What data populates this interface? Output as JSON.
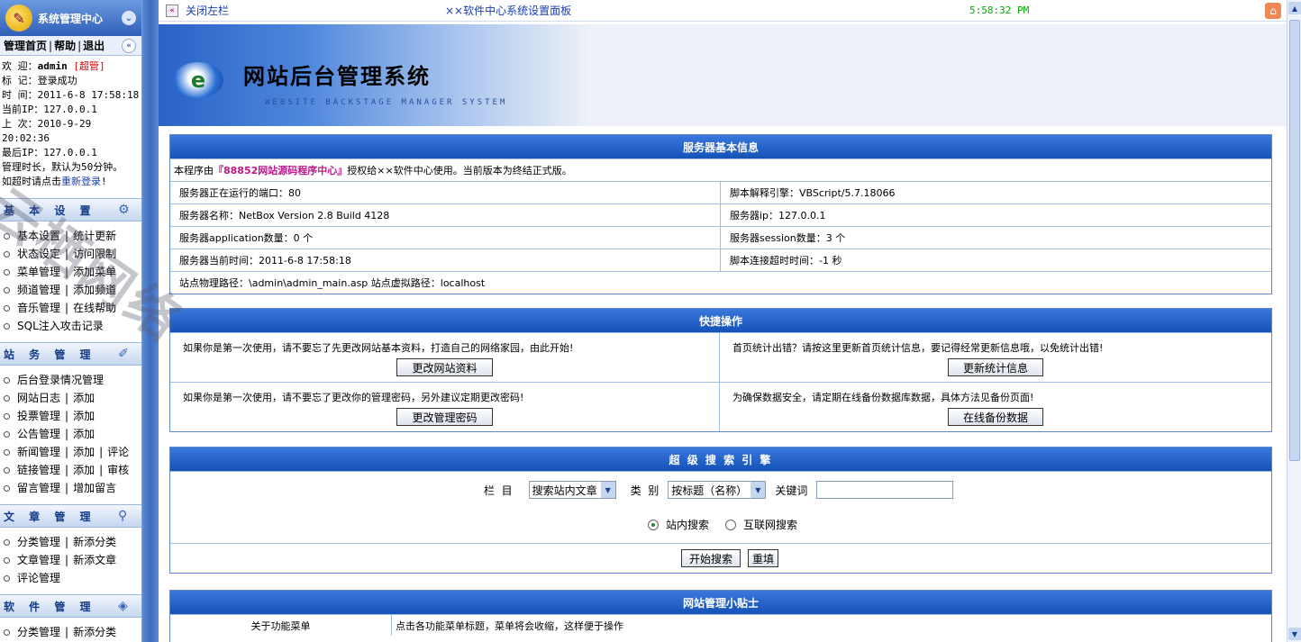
{
  "sidebar": {
    "title": "系统管理中心",
    "links": [
      "管理首页",
      "帮助",
      "退出"
    ],
    "info": {
      "welcome_label": "欢 迎：",
      "user": "admin",
      "role": "[超管]",
      "mark": "标 记：登录成功",
      "time": "时 间：2011-6-8 17:58:18",
      "ip": "当前IP：127.0.0.1",
      "last": "上 次：2010-9-29 20:02:36",
      "last_ip": "最后IP：127.0.0.1",
      "duration": "管理时长，默认为50分钟。",
      "timeout_prefix": "如超时请点击",
      "relogin": "重新登录",
      "timeout_suffix": "!"
    },
    "sections": [
      {
        "title": "基 本 设 置",
        "icon": "settings-icon",
        "items": [
          [
            "基本设置",
            "统计更新"
          ],
          [
            "状态设定",
            "访问限制"
          ],
          [
            "菜单管理",
            "添加菜单"
          ],
          [
            "频道管理",
            "添加频道"
          ],
          [
            "音乐管理",
            "在线帮助"
          ],
          [
            "SQL注入攻击记录"
          ]
        ]
      },
      {
        "title": "站 务 管 理",
        "icon": "broom-icon",
        "items": [
          [
            "后台登录情况管理"
          ],
          [
            "网站日志",
            "添加"
          ],
          [
            "投票管理",
            "添加"
          ],
          [
            "公告管理",
            "添加"
          ],
          [
            "新闻管理",
            "添加",
            "评论"
          ],
          [
            "链接管理",
            "添加",
            "审核"
          ],
          [
            "留言管理",
            "增加留言"
          ]
        ]
      },
      {
        "title": "文 章 管 理",
        "icon": "magnifier-icon",
        "items": [
          [
            "分类管理",
            "新添分类"
          ],
          [
            "文章管理",
            "新添文章"
          ],
          [
            "评论管理"
          ]
        ]
      },
      {
        "title": "软 件 管 理",
        "icon": "software-icon",
        "items": [
          [
            "分类管理",
            "新添分类"
          ]
        ]
      }
    ]
  },
  "topbar": {
    "close_left": "关闭左栏",
    "title": "××软件中心系统设置面板",
    "time": "5:58:32 PM"
  },
  "banner": {
    "title": "网站后台管理系统",
    "subtitle": "WEBSITE BACKSTAGE MANAGER SYSTEM"
  },
  "server": {
    "title": "服务器基本信息",
    "intro_prefix": "本程序由",
    "intro_highlight": "『88852网站源码程序中心』",
    "intro_suffix": "授权给××软件中心使用。当前版本为终结正式版。",
    "rows": [
      [
        "服务器正在运行的端口：80",
        "脚本解释引擎：VBScript/5.7.18066"
      ],
      [
        "服务器名称：NetBox Version 2.8 Build 4128",
        "服务器ip：127.0.0.1"
      ],
      [
        "服务器application数量：0 个",
        "服务器session数量：3 个"
      ],
      [
        "服务器当前时间：2011-6-8 17:58:18",
        "脚本连接超时时间：-1 秒"
      ]
    ],
    "path": "站点物理路径：\\admin\\admin_main.asp 站点虚拟路径：localhost"
  },
  "quick": {
    "title": "快捷操作",
    "cells": [
      {
        "text": "如果你是第一次使用，请不要忘了先更改网站基本资料，打造自己的网络家园，由此开始!",
        "button": "更改网站资料"
      },
      {
        "text": "首页统计出错？请按这里更新首页统计信息，要记得经常更新信息哦，以免统计出错!",
        "button": "更新统计信息"
      },
      {
        "text": "如果你是第一次使用，请不要忘了更改你的管理密码，另外建议定期更改密码!",
        "button": "更改管理密码"
      },
      {
        "text": "为确保数据安全，请定期在线备份数据库数据，具体方法见备份页面!",
        "button": "在线备份数据"
      }
    ]
  },
  "search": {
    "title": "超 级 搜 索 引 擎",
    "column_label": "栏  目",
    "column_value": "搜索站内文章",
    "type_label": "类  别",
    "type_value": "按标题（名称）",
    "keyword_label": "关键词",
    "keyword_value": "",
    "radio_site": "站内搜索",
    "radio_web": "互联网搜索",
    "start": "开始搜索",
    "reset": "重填"
  },
  "tips": {
    "title": "网站管理小贴士",
    "rows": [
      [
        "关于功能菜单",
        "点击各功能菜单标题，菜单将会收缩，这样便于操作"
      ]
    ]
  },
  "watermark": "云栖网络"
}
